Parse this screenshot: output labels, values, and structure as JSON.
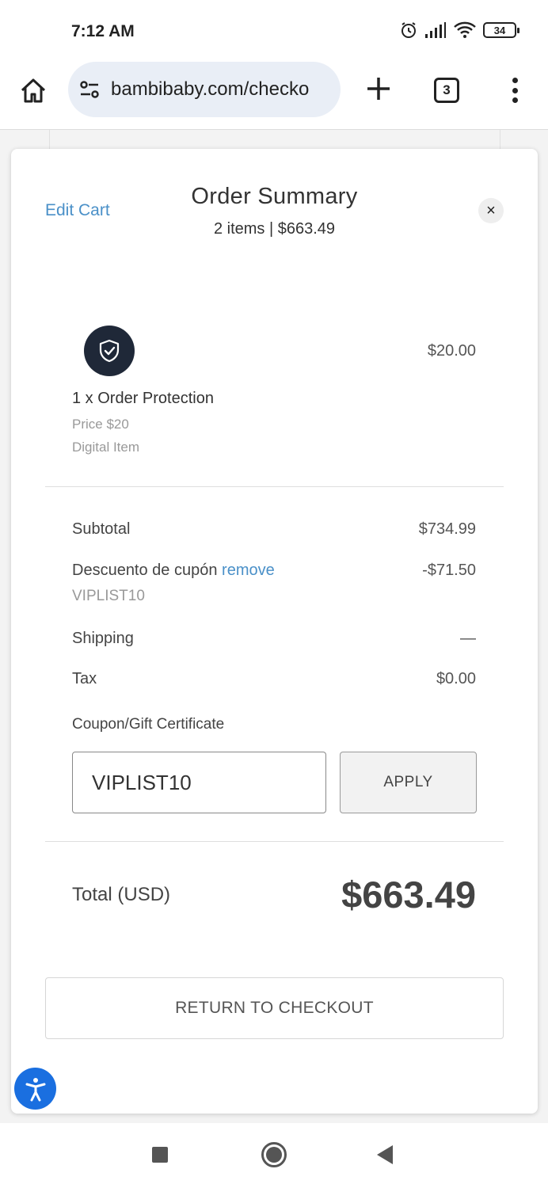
{
  "status_bar": {
    "time": "7:12 AM",
    "battery": "34"
  },
  "browser": {
    "url": "bambibaby.com/checko",
    "tab_count": "3"
  },
  "modal": {
    "edit_cart": "Edit Cart",
    "title": "Order Summary",
    "subtitle": "2 items | $663.49",
    "close": "×"
  },
  "item": {
    "price": "$20.00",
    "name": "1 x Order Protection",
    "unit_price": "Price $20",
    "type": "Digital Item"
  },
  "summary": {
    "subtotal_label": "Subtotal",
    "subtotal_value": "$734.99",
    "discount_label": "Descuento de cupón",
    "discount_remove": "remove",
    "discount_value": "-$71.50",
    "discount_code": "VIPLIST10",
    "shipping_label": "Shipping",
    "shipping_value": "—",
    "tax_label": "Tax",
    "tax_value": "$0.00"
  },
  "coupon": {
    "label": "Coupon/Gift Certificate",
    "value": "VIPLIST10",
    "apply_label": "APPLY"
  },
  "total": {
    "label": "Total (USD)",
    "value": "$663.49"
  },
  "return_label": "RETURN TO CHECKOUT",
  "colors": {
    "link": "#4a90c8",
    "shield_bg": "#1f2838",
    "accessibility_bg": "#1a6fe0"
  }
}
